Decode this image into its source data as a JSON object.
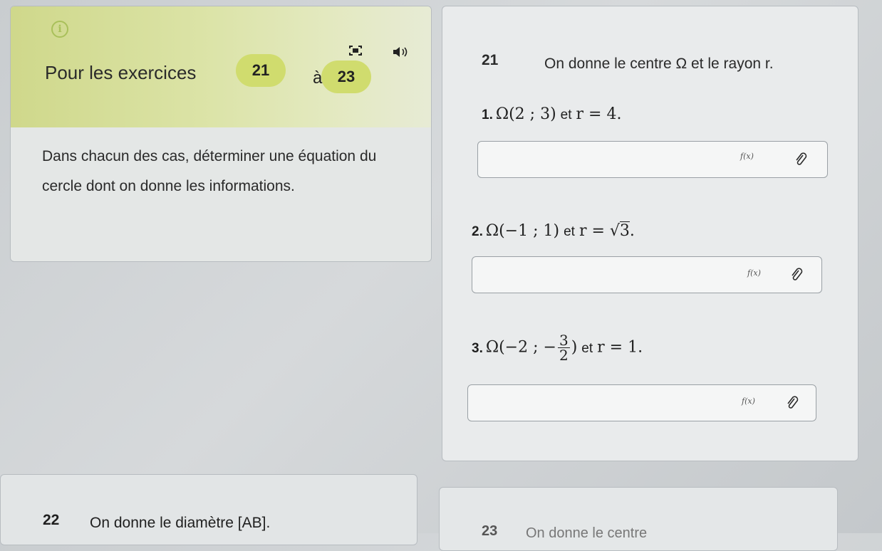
{
  "info_panel": {
    "instruction_prefix": "Pour les exercices",
    "badge_start": "21",
    "connector": "à",
    "badge_end": "23",
    "body": "Dans chacun des cas, déterminer une équation du cercle dont on donne les informations."
  },
  "exercise_21": {
    "number": "21",
    "statement": "On donne le centre Ω et le rayon r.",
    "questions": [
      {
        "n": "1.",
        "center": "Ω(2 ; 3)",
        "et": "et",
        "radius": "r = 4.",
        "fx": "f(x)"
      },
      {
        "n": "2.",
        "center": "Ω(−1 ; 1)",
        "et": "et",
        "radius_prefix": "r = ",
        "radius_sqrt": "3",
        "radius_suffix": ".",
        "fx": "f(x)"
      },
      {
        "n": "3.",
        "center_prefix": "Ω(−2 ; −",
        "frac_num": "3",
        "frac_den": "2",
        "center_suffix": ")",
        "et": "et",
        "radius": "r = 1.",
        "fx": "f(x)"
      }
    ]
  },
  "exercise_22": {
    "number": "22",
    "statement": "On donne le diamètre [AB]."
  },
  "exercise_23": {
    "number": "23",
    "statement": "On donne le centre"
  },
  "colors": {
    "badge": "#d0dc6e",
    "banner": "#dbe3a6",
    "accent_icon": "#a9c05a"
  },
  "icons": [
    "info-icon",
    "fullscreen-icon",
    "audio-icon",
    "attach-icon"
  ]
}
